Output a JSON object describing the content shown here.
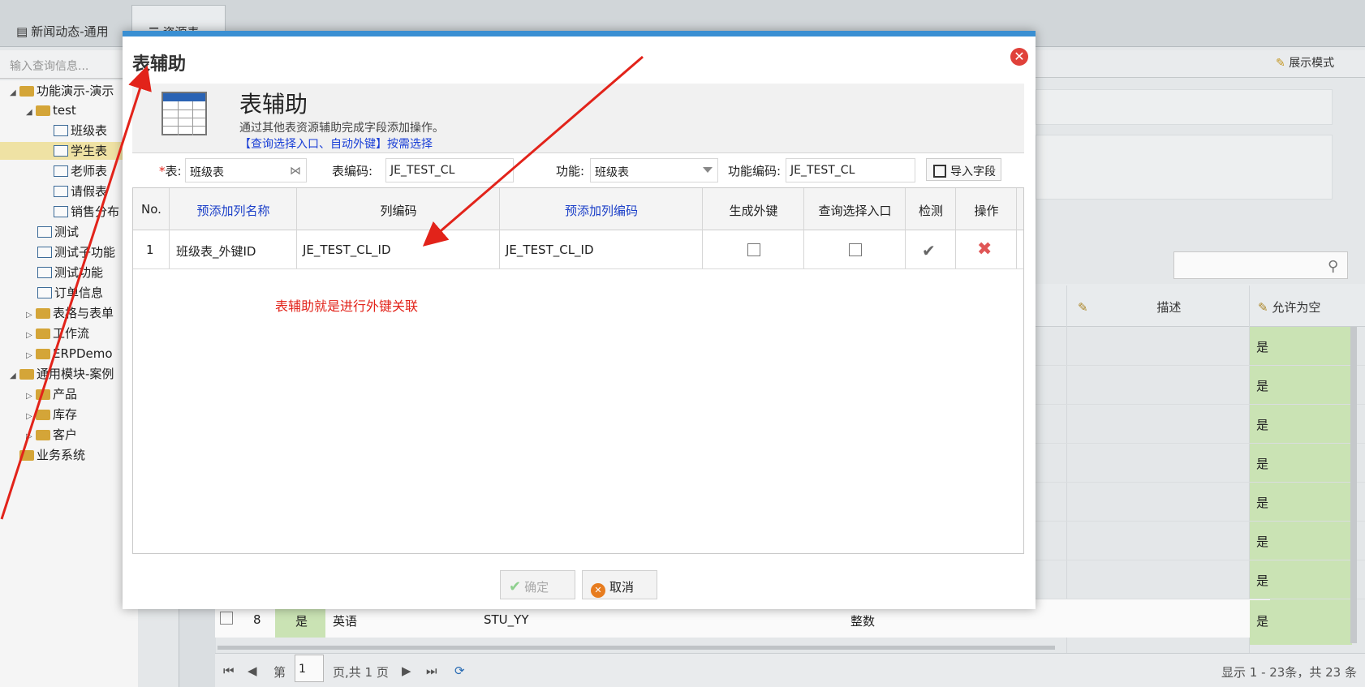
{
  "app": {
    "tabs": [
      {
        "label": "新闻动态-通用",
        "icon": "news-icon"
      },
      {
        "label": "资源表",
        "icon": "database-icon"
      }
    ],
    "search_placeholder": "输入查询信息...",
    "display_mode_label": "展示模式",
    "tree": [
      {
        "label": "功能演示-演示",
        "arrow": "◢"
      },
      {
        "label": "test",
        "arrow": "◢"
      },
      {
        "label": "班级表"
      },
      {
        "label": "学生表"
      },
      {
        "label": "老师表"
      },
      {
        "label": "请假表"
      },
      {
        "label": "销售分布"
      },
      {
        "label": "测试"
      },
      {
        "label": "测试子功能"
      },
      {
        "label": "测试功能"
      },
      {
        "label": "订单信息"
      },
      {
        "label": "表格与表单",
        "arrow": "▷"
      },
      {
        "label": "工作流",
        "arrow": "▷"
      },
      {
        "label": "ERPDemo",
        "arrow": "▷"
      },
      {
        "label": "通用模块-案例",
        "arrow": "◢"
      },
      {
        "label": "产品",
        "arrow": "▷"
      },
      {
        "label": "库存",
        "arrow": "▷"
      },
      {
        "label": "客户",
        "arrow": "▷"
      },
      {
        "label": "业务系统"
      }
    ],
    "grid": {
      "headers": {
        "desc": "描述",
        "allow_null": "允许为空"
      },
      "allow_values": [
        "是",
        "是",
        "是",
        "是",
        "是",
        "是",
        "是",
        "是"
      ],
      "row8": {
        "num": "8",
        "yes": "是",
        "name": "英语",
        "code": "STU_YY",
        "type": "整数",
        "allow": "是"
      }
    },
    "pager": {
      "page_prefix": "第",
      "page_value": "1",
      "page_suffix": "页,共 1 页",
      "summary": "显示 1 - 23条，共 23 条"
    }
  },
  "dialog": {
    "title": "表辅助",
    "banner": {
      "title": "表辅助",
      "description": "通过其他表资源辅助完成字段添加操作。",
      "link": "【查询选择入口、自动外键】按需选择"
    },
    "form": {
      "table_label": "表:",
      "table_required": "*",
      "table_value": "班级表",
      "table_code_label": "表编码:",
      "table_code_value": "JE_TEST_CL",
      "function_label": "功能:",
      "function_value": "班级表",
      "function_code_label": "功能编码:",
      "function_code_value": "JE_TEST_CL",
      "import_button": "导入字段"
    },
    "columns": [
      "No.",
      "预添加列名称",
      "列编码",
      "预添加列编码",
      "生成外键",
      "查询选择入口",
      "检测",
      "操作"
    ],
    "rows": [
      {
        "no": "1",
        "name": "班级表_外键ID",
        "code": "JE_TEST_CL_ID",
        "pre_code": "JE_TEST_CL_ID",
        "fk": false,
        "query_entry": false
      }
    ],
    "annotation": "表辅助就是进行外键关联",
    "buttons": {
      "ok": "确定",
      "cancel": "取消"
    }
  },
  "colors": {
    "accent": "#3a8fd2",
    "link": "#1a3fd6",
    "annotation": "#e2231a",
    "allow_col": "#cfe8b8"
  }
}
